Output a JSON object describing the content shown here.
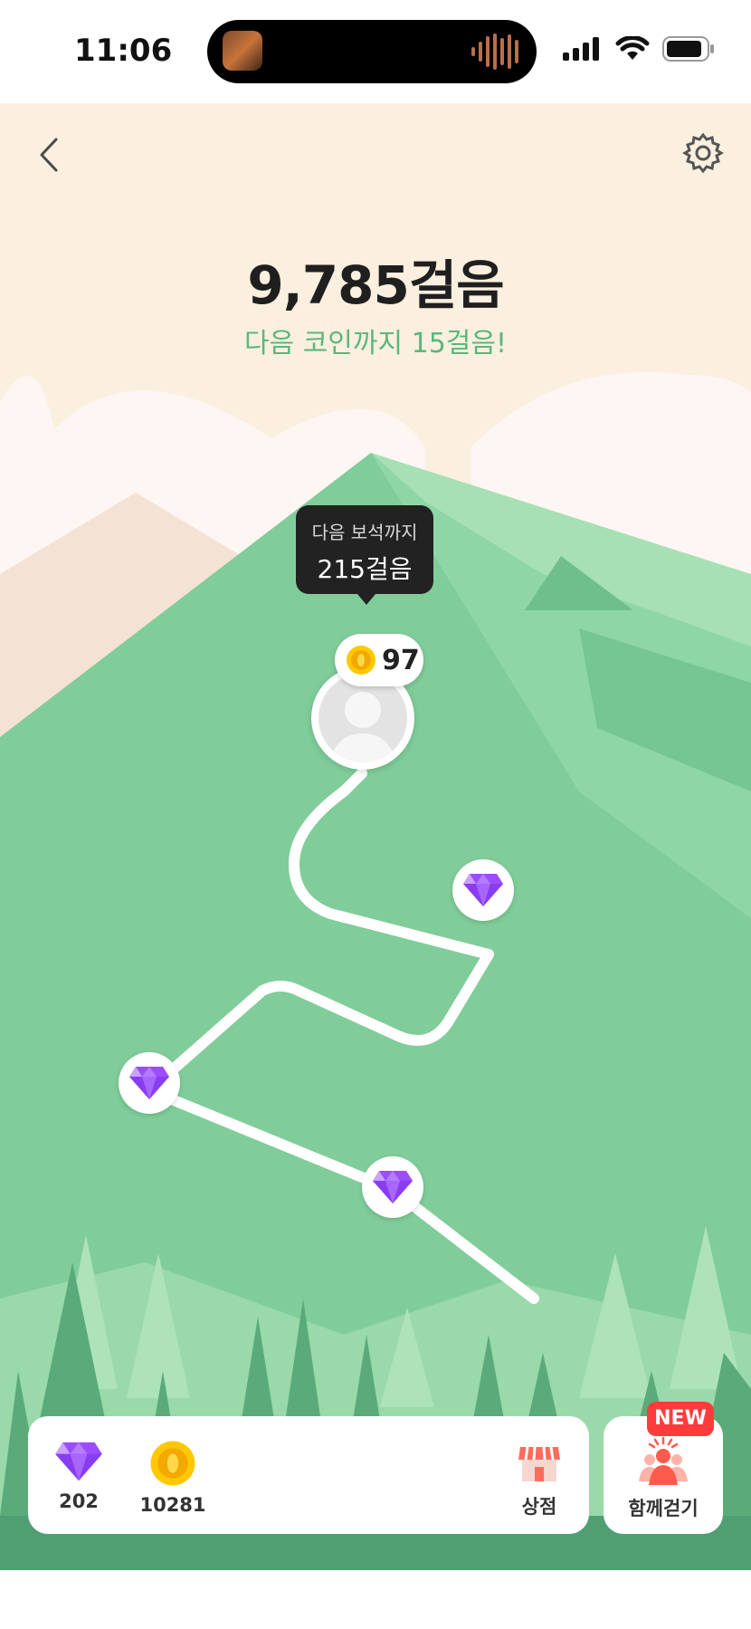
{
  "status_bar": {
    "time": "11:06"
  },
  "header": {
    "steps_text": "9,785걸음",
    "next_coin_text": "다음 코인까지 15걸음!"
  },
  "tooltip": {
    "line1": "다음 보석까지",
    "line2": "215걸음"
  },
  "avatar": {
    "coin_count": "97"
  },
  "bottom_panel": {
    "gems": "202",
    "coins": "10281",
    "shop_label": "상점",
    "together_label": "함께걷기",
    "new_badge": "NEW"
  },
  "colors": {
    "background": "#fbefdf",
    "mountain": "#80cd9a",
    "accent_green": "#5bb77a",
    "gem": "#9b4dff",
    "coin": "#ffc800",
    "new_badge": "#ff3b3b"
  },
  "icons": [
    "back-arrow-icon",
    "gear-icon",
    "gem-icon",
    "coin-icon",
    "shop-icon",
    "walk-together-icon"
  ]
}
